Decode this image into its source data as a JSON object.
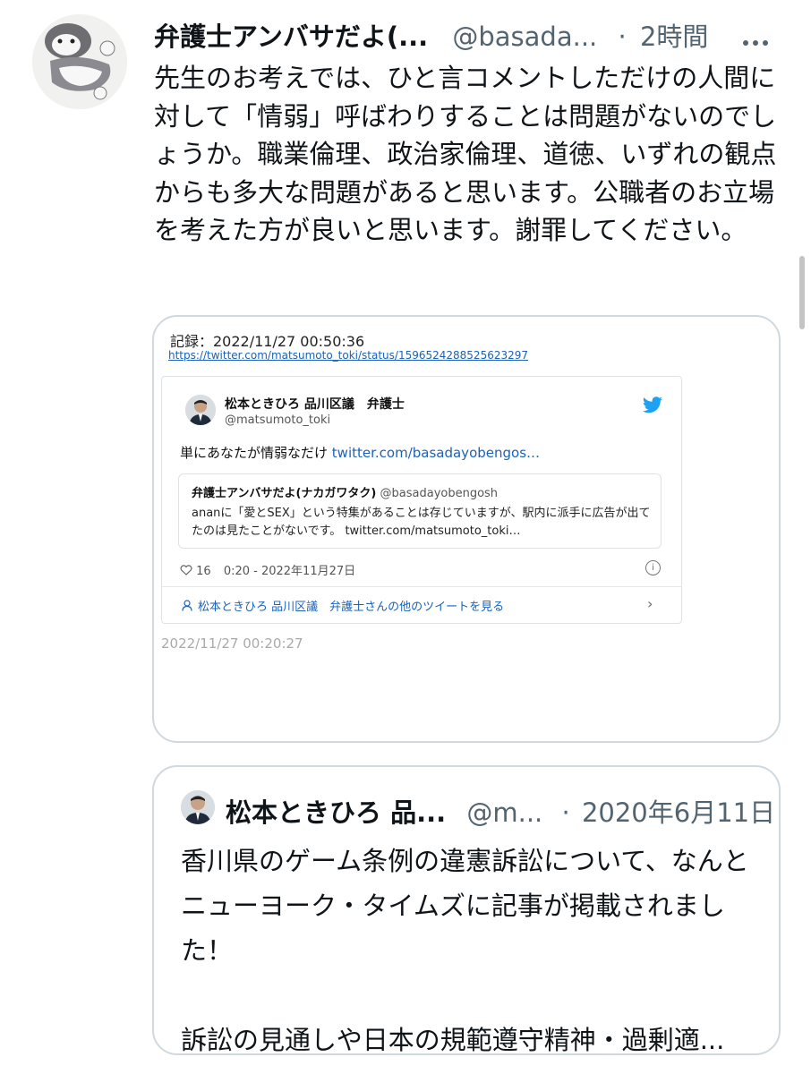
{
  "tweet": {
    "display_name": "弁護士アンバサだよ(...",
    "handle": "@basada...",
    "separator": "·",
    "timestamp": "2時間",
    "more_icon": "more-horizontal-icon",
    "body": "先生のお考えでは、ひと言コメントしただけの人間に対して「情弱」呼ばわりすることは問題がないのでしょうか。職業倫理、政治家倫理、道徳、いずれの観点からも多大な問題があると思います。公職者のお立場を考えた方が良いと思います。謝罪してください。"
  },
  "media": {
    "record_title": "記録：2022/11/27 00:50:36",
    "record_url": "https://twitter.com/matsumoto_toki/status/1596524288525623297",
    "embed": {
      "name": "松本ときひろ 品川区議　弁護士",
      "handle": "@matsumoto_toki",
      "text": "単にあなたが情弱なだけ",
      "text_link": "twitter.com/basadayobengos…",
      "quoted": {
        "name": "弁護士アンバサだよ(ナカガワタク)",
        "handle": "@basadayobengosh",
        "body": "ananに「愛とSEX」という特集があることは存じていますが、駅内に派手に広告が出てたのは見たことがないです。 twitter.com/matsumoto_toki…"
      },
      "likes": "16",
      "time_date": "0:20 - 2022年11月27日",
      "footer_link": "松本ときひろ 品川区議　弁護士さんの他のツイートを見る"
    },
    "capture_timestamp": "2022/11/27 00:20:27"
  },
  "quoted_tweet": {
    "display_name": "松本ときひろ 品...",
    "handle": "@m...",
    "separator": "·",
    "date": "2020年6月11日",
    "body": "香川県のゲーム条例の違憲訴訟について、なんとニューヨーク・タイムズに記事が掲載されました！\n\n訴訟の見通しや日本の規範遵守精神・過剰適..."
  },
  "colors": {
    "text_primary": "#0f1419",
    "text_secondary": "#536471",
    "border": "#cfd9de",
    "link": "#1b62b8",
    "twitter_blue": "#1da1f2"
  }
}
